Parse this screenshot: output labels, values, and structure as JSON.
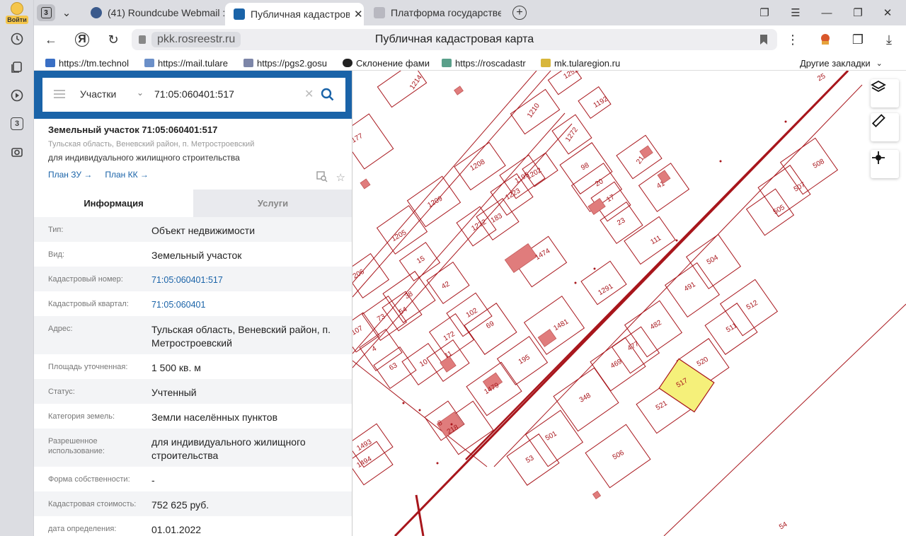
{
  "sidebar": {
    "login_label": "Войти",
    "tabs_badge": "3"
  },
  "tabs": {
    "count": "3",
    "items": [
      {
        "label": "(41) Roundcube Webmail :"
      },
      {
        "label": "Публичная кадастровая"
      },
      {
        "label": "Платформа государствен"
      }
    ],
    "new_tab": "+"
  },
  "nav": {
    "domain": "pkk.rosreestr.ru",
    "page_title": "Публичная кадастровая карта"
  },
  "bookmarks": {
    "items": [
      {
        "label": "https://tm.technol"
      },
      {
        "label": "https://mail.tulare"
      },
      {
        "label": "https://pgs2.gosu"
      },
      {
        "label": "Склонение фами"
      },
      {
        "label": "https://roscadastr"
      },
      {
        "label": "mk.tularegion.ru"
      }
    ],
    "other": "Другие закладки"
  },
  "search": {
    "layer": "Участки",
    "query": "71:05:060401:517"
  },
  "object": {
    "title": "Земельный участок 71:05:060401:517",
    "address": "Тульская область, Веневский район, п. Метростроевский",
    "use": "для индивидуального жилищного строительства",
    "link_zu": "План ЗУ →",
    "link_kk": "План КК →"
  },
  "info_tabs": {
    "info": "Информация",
    "services": "Услуги"
  },
  "rows": [
    {
      "k": "Тип:",
      "v": "Объект недвижимости"
    },
    {
      "k": "Вид:",
      "v": "Земельный участок"
    },
    {
      "k": "Кадастровый номер:",
      "v": "71:05:060401:517"
    },
    {
      "k": "Кадастровый квартал:",
      "v": "71:05:060401"
    },
    {
      "k": "Адрес:",
      "v": "Тульская область, Веневский район, п. Метростроевский"
    },
    {
      "k": "Площадь уточненная:",
      "v": "1 500 кв. м"
    },
    {
      "k": "Статус:",
      "v": "Учтенный"
    },
    {
      "k": "Категория земель:",
      "v": "Земли населённых пунктов"
    },
    {
      "k": "Разрешенное использование:",
      "v": "для индивидуального жилищного строительства"
    },
    {
      "k": "Форма собственности:",
      "v": "-"
    },
    {
      "k": "Кадастровая стоимость:",
      "v": "752 625 руб."
    },
    {
      "k": "дата определения:",
      "v": "01.01.2022"
    }
  ],
  "map": {
    "labels": [
      "1214",
      "1252",
      "25",
      "1210",
      "1192",
      "177",
      "1272",
      "1208",
      "98",
      "21",
      "508",
      "1209",
      "1195",
      "1202",
      "20",
      "41",
      "507",
      "1223",
      "17",
      "505",
      "183",
      "1232",
      "23",
      "1205",
      "15",
      "1474",
      "111",
      "504",
      "206",
      "38",
      "42",
      "491",
      "512",
      "73",
      "54",
      "102",
      "1291",
      "69",
      "1481",
      "482",
      "511",
      "107",
      "172",
      "477",
      "4",
      "520",
      "63",
      "10",
      "11",
      "195",
      "469",
      "517",
      "1479",
      "348",
      "521",
      "8",
      "218",
      "501",
      "1493",
      "1494",
      "53",
      "506",
      "54"
    ],
    "selected": "517",
    "selected_color": "#f5f07a",
    "line_color": "#a8161c"
  }
}
